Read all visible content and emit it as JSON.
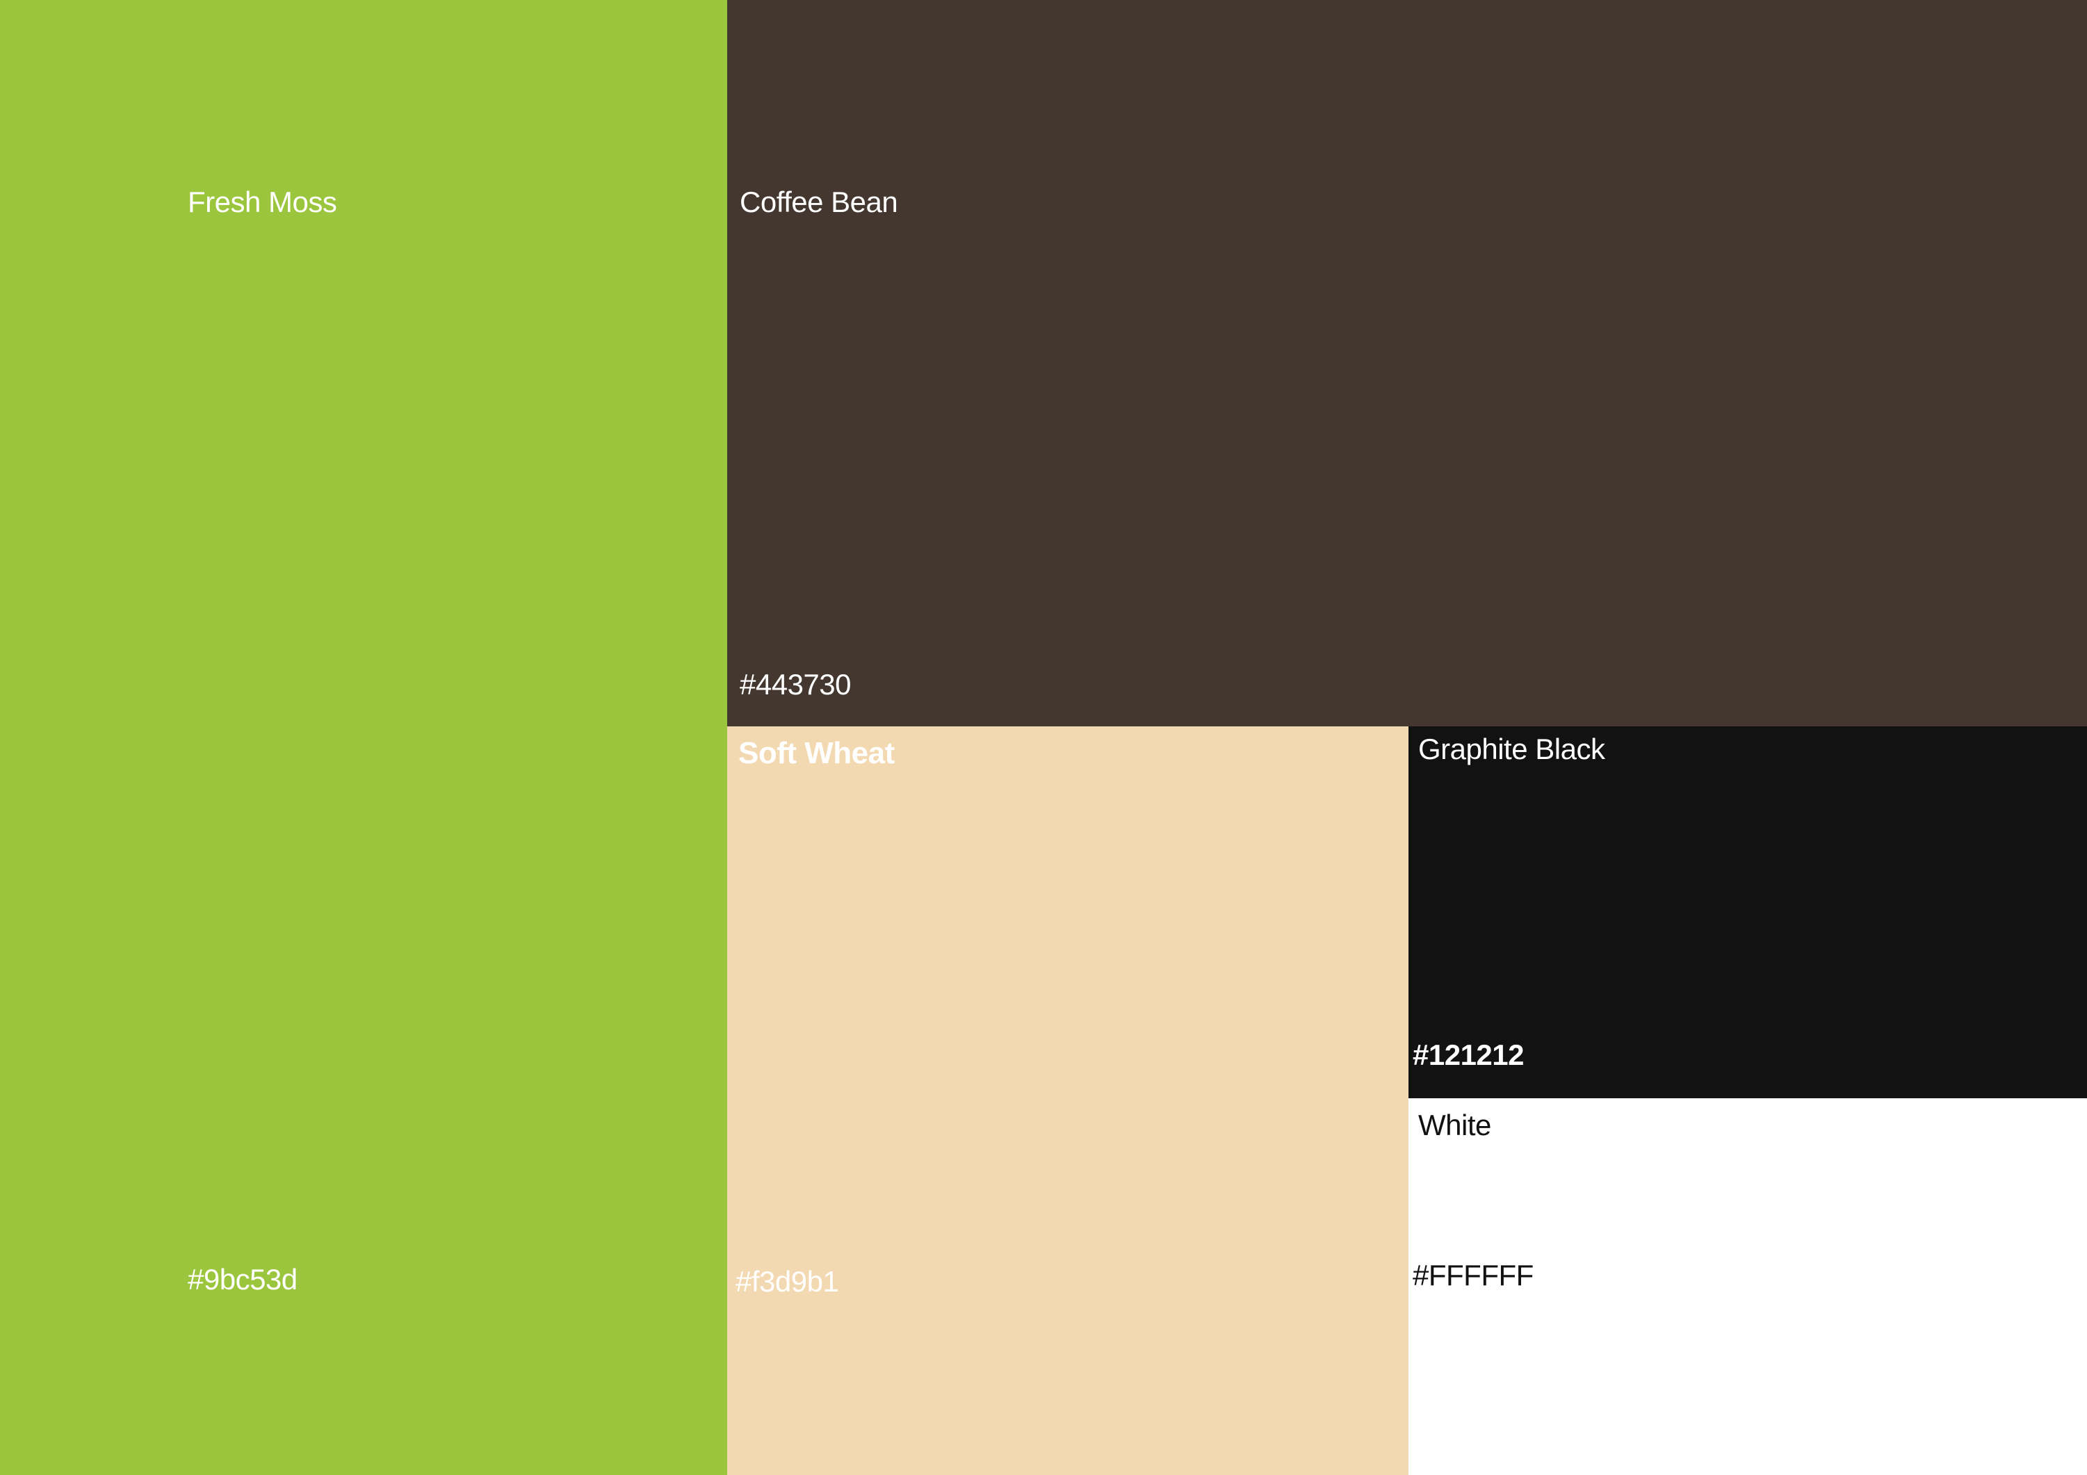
{
  "swatches": [
    {
      "name": "Fresh Moss",
      "hex_label": "#9bc53d",
      "color": "#9bc53d"
    },
    {
      "name": "Coffee Bean",
      "hex_label": "#443730",
      "color": "#443730"
    },
    {
      "name": "Soft Wheat",
      "hex_label": "#f3d9b1",
      "color": "#f3d9b1"
    },
    {
      "name": "Graphite Black",
      "hex_label": "#121212",
      "color": "#121212"
    },
    {
      "name": "White",
      "hex_label": "#FFFFFF",
      "color": "#FFFFFF"
    }
  ]
}
